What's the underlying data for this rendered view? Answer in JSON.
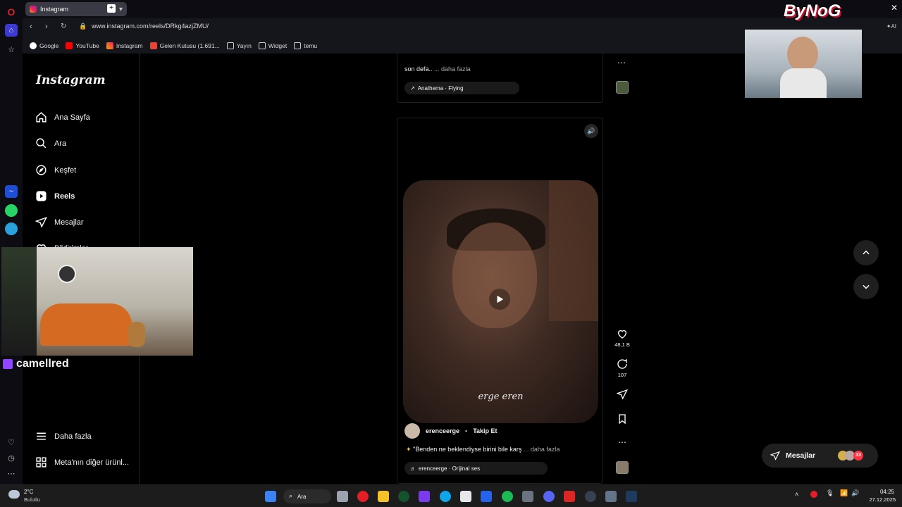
{
  "browser": {
    "tab_title": "Instagram",
    "url": "www.instagram.com/reels/DRkg4azjZMU/",
    "bookmarks": [
      "Google",
      "YouTube",
      "Instagram",
      "Gelen Kutusu (1.691...",
      "Yayın",
      "Widget",
      "temu"
    ]
  },
  "sidebar": {
    "logo": "Instagram",
    "items": [
      {
        "label": "Ana Sayfa"
      },
      {
        "label": "Ara"
      },
      {
        "label": "Keşfet"
      },
      {
        "label": "Reels"
      },
      {
        "label": "Mesajlar"
      },
      {
        "label": "Bildirimler"
      }
    ],
    "more": "Daha fazla",
    "meta": "Meta'nın diğer ürünl..."
  },
  "prev_post": {
    "caption": "son defa..",
    "more": "... daha fazla",
    "music": "Anathema · Flying"
  },
  "reel": {
    "watermark": "erge eren",
    "username": "erenceerge",
    "follow": "Takip Et",
    "caption": "\"Benden ne beklendiyse birini bile karş",
    "more": "... daha fazla",
    "music": "erenceerge · Orijinal ses",
    "likes": "48,1 B",
    "comments": "107"
  },
  "messages": {
    "label": "Mesajlar",
    "badge": "33"
  },
  "overlay": {
    "twitch_user": "camellred",
    "logo": "ByNoG"
  },
  "taskbar": {
    "weather_temp": "2°C",
    "weather_desc": "Bulutlu",
    "search": "Ara",
    "time": "04:25",
    "date": "27.12.2025"
  },
  "colors": {
    "accent_blue": "#0095f6",
    "twitch_purple": "#9146ff",
    "opera_red": "#e41e26"
  }
}
